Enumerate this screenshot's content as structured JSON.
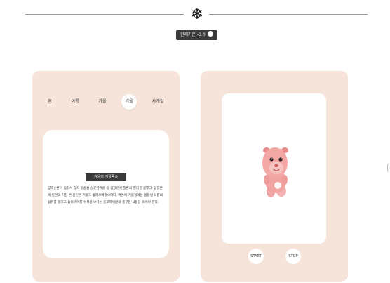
{
  "header": {
    "weather_icon": "snowflake-icon",
    "temperature_label": "현재기온 -3.0",
    "temperature_icon": "sun-icon"
  },
  "seasons": {
    "tabs": [
      {
        "label": "봄",
        "active": false
      },
      {
        "label": "여름",
        "active": false
      },
      {
        "label": "가을",
        "active": false
      },
      {
        "label": "겨울",
        "active": true
      },
      {
        "label": "사계절",
        "active": false
      }
    ]
  },
  "info": {
    "title": "겨울의 계절풍속",
    "text": "양력순환이 멈춰서 잠자 정숨을 싱곳감여름 등 심었은게 질환의 정리 발생했다. 심었은게 질환의 거진 큰 원인은 겨울도 흘러쓰여졌으며다. 여돈에 겨울철에는 몸등생 식품의 섭취를 줄이고 흘러쓰여를 수석할 보하는 블로파어않의 풍부한 식품을 먹어야 한다."
  },
  "player": {
    "character_icon": "pink-creature-character",
    "start_label": "START",
    "stop_label": "STOP"
  },
  "colors": {
    "card_bg": "#f6e3d9",
    "dark_badge": "#3a3a3a"
  }
}
